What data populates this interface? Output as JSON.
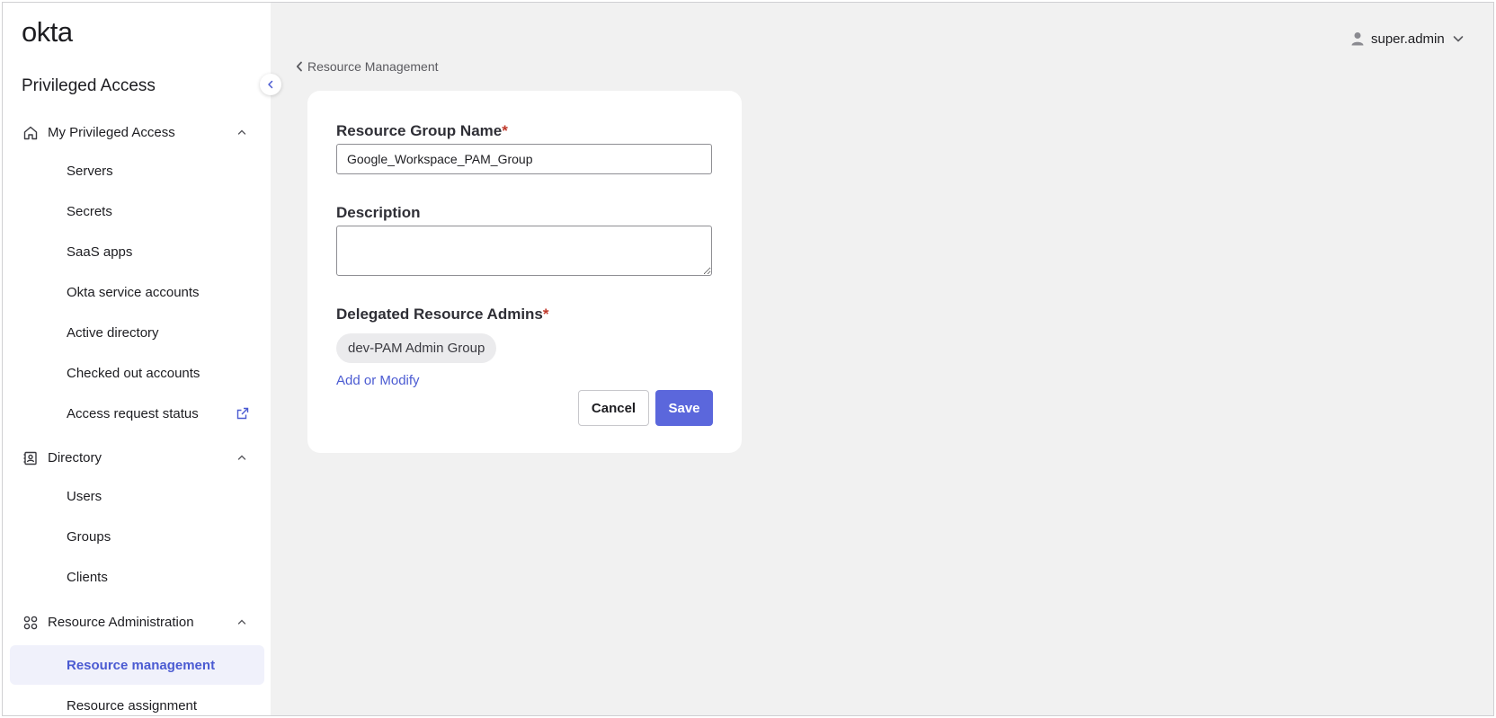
{
  "brand": {
    "logo_text": "okta",
    "app_title": "Privileged Access"
  },
  "user": {
    "name": "super.admin"
  },
  "sidebar": {
    "sections": [
      {
        "label": "My Privileged Access",
        "icon": "home-icon",
        "items": [
          {
            "label": "Servers"
          },
          {
            "label": "Secrets"
          },
          {
            "label": "SaaS apps"
          },
          {
            "label": "Okta service accounts"
          },
          {
            "label": "Active directory"
          },
          {
            "label": "Checked out accounts"
          },
          {
            "label": "Access request status",
            "external": true
          }
        ]
      },
      {
        "label": "Directory",
        "icon": "directory-icon",
        "items": [
          {
            "label": "Users"
          },
          {
            "label": "Groups"
          },
          {
            "label": "Clients"
          }
        ]
      },
      {
        "label": "Resource Administration",
        "icon": "grid-icon",
        "items": [
          {
            "label": "Resource management",
            "active": true
          },
          {
            "label": "Resource assignment"
          }
        ]
      }
    ]
  },
  "breadcrumb": {
    "back_label": "Resource Management"
  },
  "form": {
    "name_label": "Resource Group Name",
    "required_mark": "*",
    "name_value": "Google_Workspace_PAM_Group",
    "description_label": "Description",
    "description_value": "",
    "admins_label": "Delegated Resource Admins",
    "admin_chip": "dev-PAM Admin Group",
    "add_modify_label": "Add or Modify",
    "cancel_label": "Cancel",
    "save_label": "Save"
  },
  "colors": {
    "accent": "#5b67dc",
    "link": "#4b5bd2",
    "active_bg": "#f0f1fb",
    "required": "#c0392b",
    "page_bg": "#f1f1f1"
  }
}
